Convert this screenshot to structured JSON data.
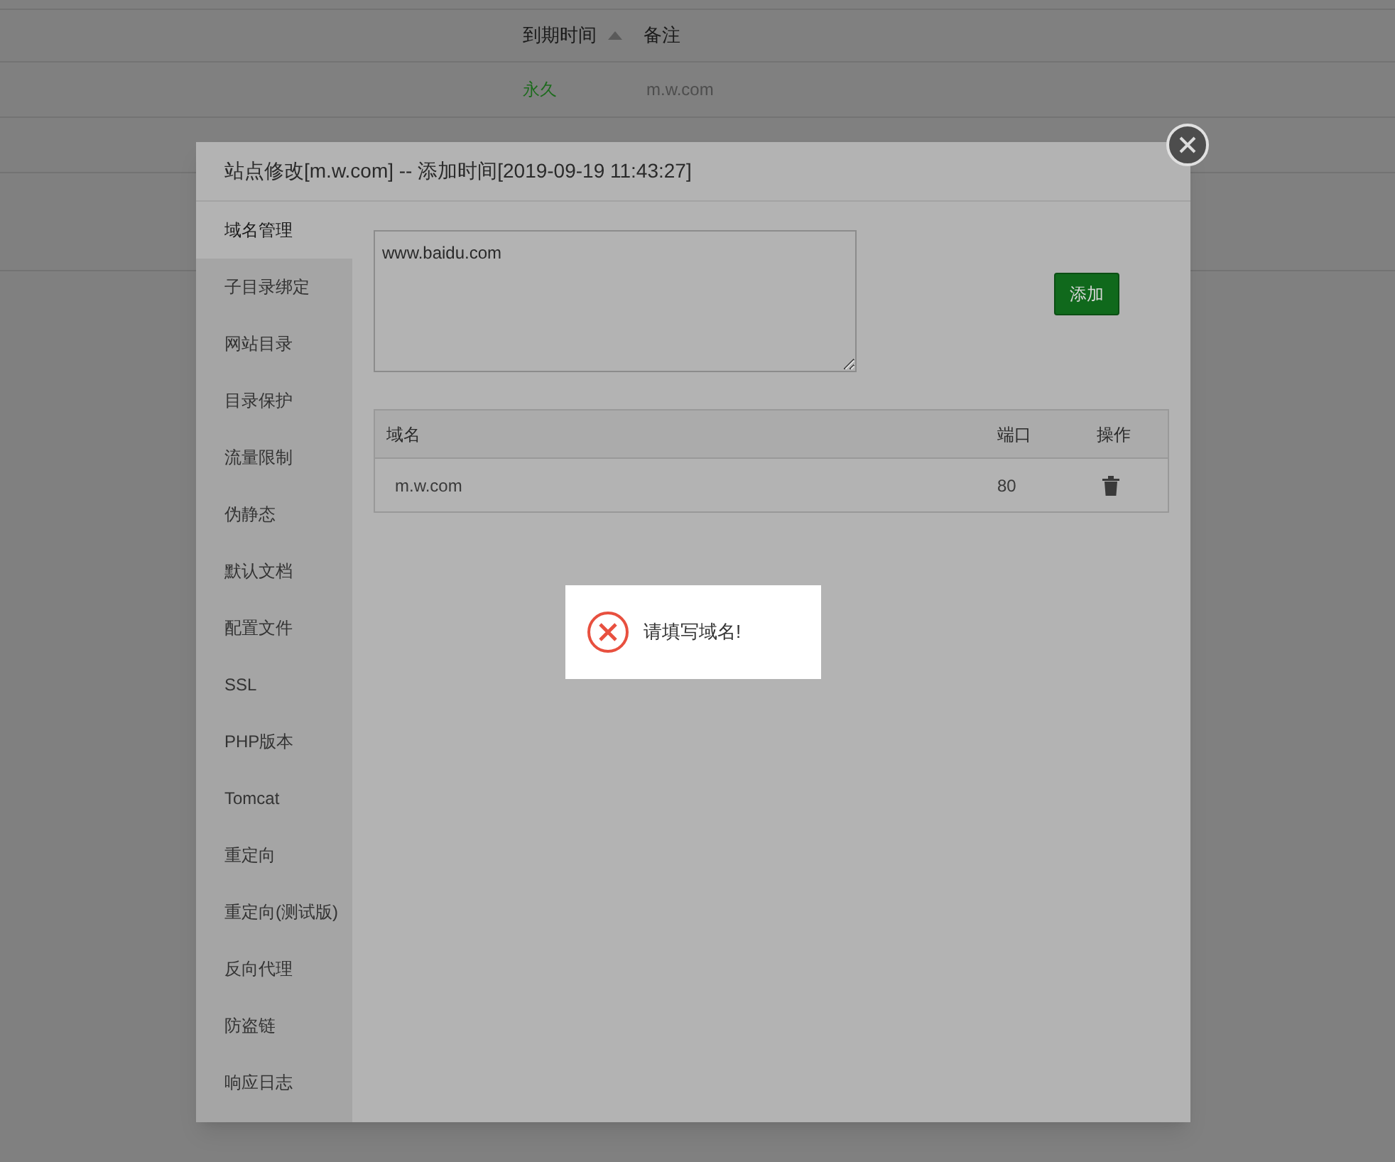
{
  "background_table": {
    "columns": [
      {
        "label": "到期时间",
        "sorted": true
      },
      {
        "label": "备注",
        "sorted": false
      }
    ],
    "rows": [
      {
        "expiry": "永久",
        "note": "m.w.com"
      }
    ]
  },
  "dialog": {
    "title": "站点修改[m.w.com] -- 添加时间[2019-09-19 11:43:27]",
    "sidebar": [
      {
        "label": "域名管理",
        "selected": true
      },
      {
        "label": "子目录绑定",
        "selected": false
      },
      {
        "label": "网站目录",
        "selected": false
      },
      {
        "label": "目录保护",
        "selected": false
      },
      {
        "label": "流量限制",
        "selected": false
      },
      {
        "label": "伪静态",
        "selected": false
      },
      {
        "label": "默认文档",
        "selected": false
      },
      {
        "label": "配置文件",
        "selected": false
      },
      {
        "label": "SSL",
        "selected": false
      },
      {
        "label": "PHP版本",
        "selected": false
      },
      {
        "label": "Tomcat",
        "selected": false
      },
      {
        "label": "重定向",
        "selected": false
      },
      {
        "label": "重定向(测试版)",
        "selected": false
      },
      {
        "label": "反向代理",
        "selected": false
      },
      {
        "label": "防盗链",
        "selected": false
      },
      {
        "label": "响应日志",
        "selected": false
      }
    ],
    "domain_input": {
      "value": "www.baidu.com"
    },
    "add_button": "添加",
    "domain_table": {
      "columns": [
        "域名",
        "端口",
        "操作"
      ],
      "rows": [
        {
          "domain": "m.w.com",
          "port": "80"
        }
      ]
    }
  },
  "toast": {
    "kind": "error",
    "message": "请填写域名!"
  }
}
